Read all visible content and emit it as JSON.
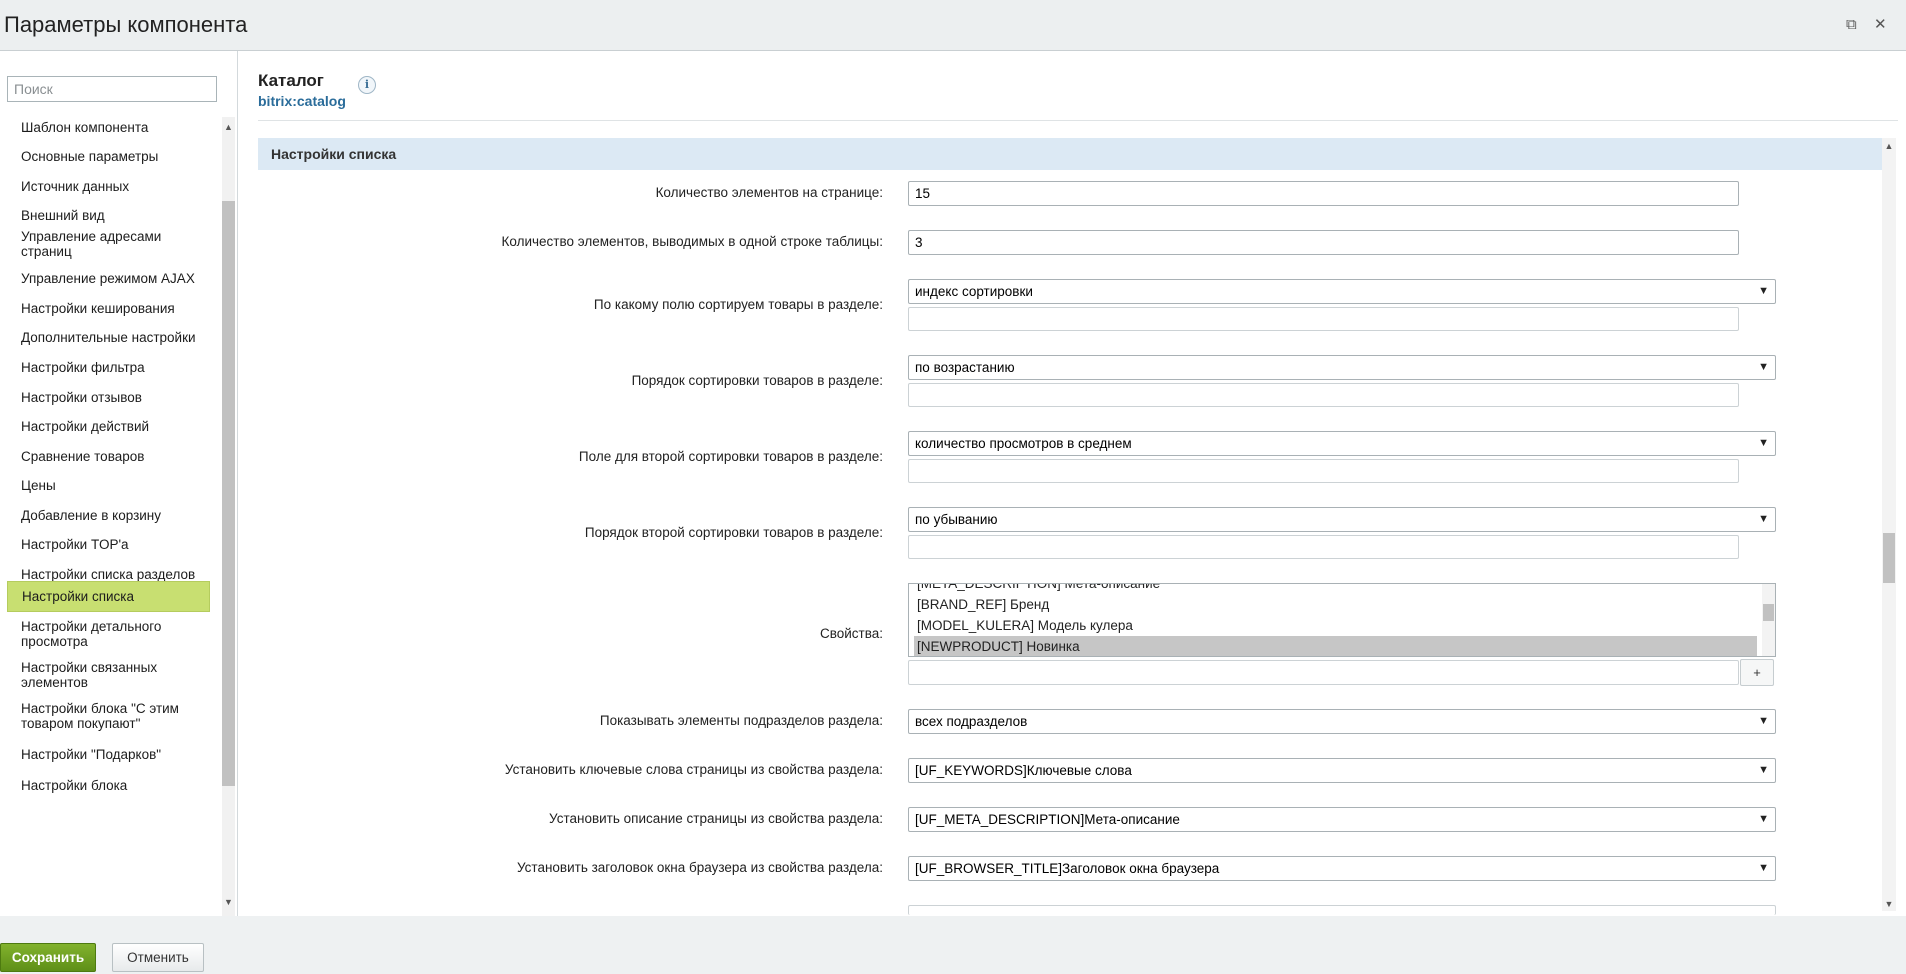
{
  "window": {
    "title": "Параметры компонента",
    "restore_glyph": "⧉",
    "close_glyph": "✕"
  },
  "sidebar": {
    "search_placeholder": "Поиск",
    "items": [
      {
        "label": "Шаблон компонента"
      },
      {
        "label": "Основные параметры"
      },
      {
        "label": "Источник данных"
      },
      {
        "label": "Внешний вид"
      },
      {
        "label": "Управление адресами страниц"
      },
      {
        "label": "Управление режимом AJAX"
      },
      {
        "label": "Настройки кеширования"
      },
      {
        "label": "Дополнительные настройки"
      },
      {
        "label": "Настройки фильтра"
      },
      {
        "label": "Настройки отзывов"
      },
      {
        "label": "Настройки действий"
      },
      {
        "label": "Сравнение товаров"
      },
      {
        "label": "Цены"
      },
      {
        "label": "Добавление в корзину"
      },
      {
        "label": "Настройки TOP'а"
      },
      {
        "label": "Настройки списка разделов"
      },
      {
        "label": "Настройки списка",
        "active": true
      },
      {
        "label": "Настройки детального просмотра"
      },
      {
        "label": "Настройки связанных элементов"
      },
      {
        "label": "Настройки блока \"С этим товаром покупают\""
      },
      {
        "label": "Настройки \"Подарков\""
      },
      {
        "label": "Настройки блока"
      }
    ]
  },
  "component": {
    "name": "Каталог",
    "id": "bitrix:catalog",
    "info_icon": "i"
  },
  "section": {
    "title": "Настройки списка"
  },
  "fields": {
    "page_count": {
      "label": "Количество элементов на странице:",
      "value": "15"
    },
    "line_count": {
      "label": "Количество элементов, выводимых в одной строке таблицы:",
      "value": "3"
    },
    "sort1": {
      "label": "По какому полю сортируем товары в разделе:",
      "value": "индекс сортировки"
    },
    "order1": {
      "label": "Порядок сортировки товаров в разделе:",
      "value": "по возрастанию"
    },
    "sort2": {
      "label": "Поле для второй сортировки товаров в разделе:",
      "value": "количество просмотров в среднем"
    },
    "order2": {
      "label": "Порядок второй сортировки товаров в разделе:",
      "value": "по убыванию"
    },
    "properties": {
      "label": "Свойства:",
      "options": [
        "[META_DESCRIPTION] Мета-описание",
        "[BRAND_REF] Бренд",
        "[MODEL_KULERA] Модель кулера",
        "[NEWPRODUCT] Новинка"
      ],
      "selected": "[NEWPRODUCT] Новинка",
      "add_label": "+"
    },
    "subsections": {
      "label": "Показывать элементы подразделов раздела:",
      "value": "всех подразделов"
    },
    "keywords": {
      "label": "Установить ключевые слова страницы из свойства раздела:",
      "value": "[UF_KEYWORDS]Ключевые слова"
    },
    "description": {
      "label": "Установить описание страницы из свойства раздела:",
      "value": "[UF_META_DESCRIPTION]Мета-описание"
    },
    "browser_title": {
      "label": "Установить заголовок окна браузера из свойства раздела:",
      "value": "[UF_BROWSER_TITLE]Заголовок окна браузера"
    }
  },
  "footer": {
    "save_label": "Сохранить",
    "cancel_label": "Отменить"
  },
  "colors": {
    "accent": "#c8df71",
    "save_button": "#6a9b1f",
    "section_bg": "#dce9f4",
    "link": "#2a6c9a"
  },
  "icons": {
    "select_arrow": "▼",
    "scroll_up": "▲",
    "scroll_down": "▼"
  }
}
